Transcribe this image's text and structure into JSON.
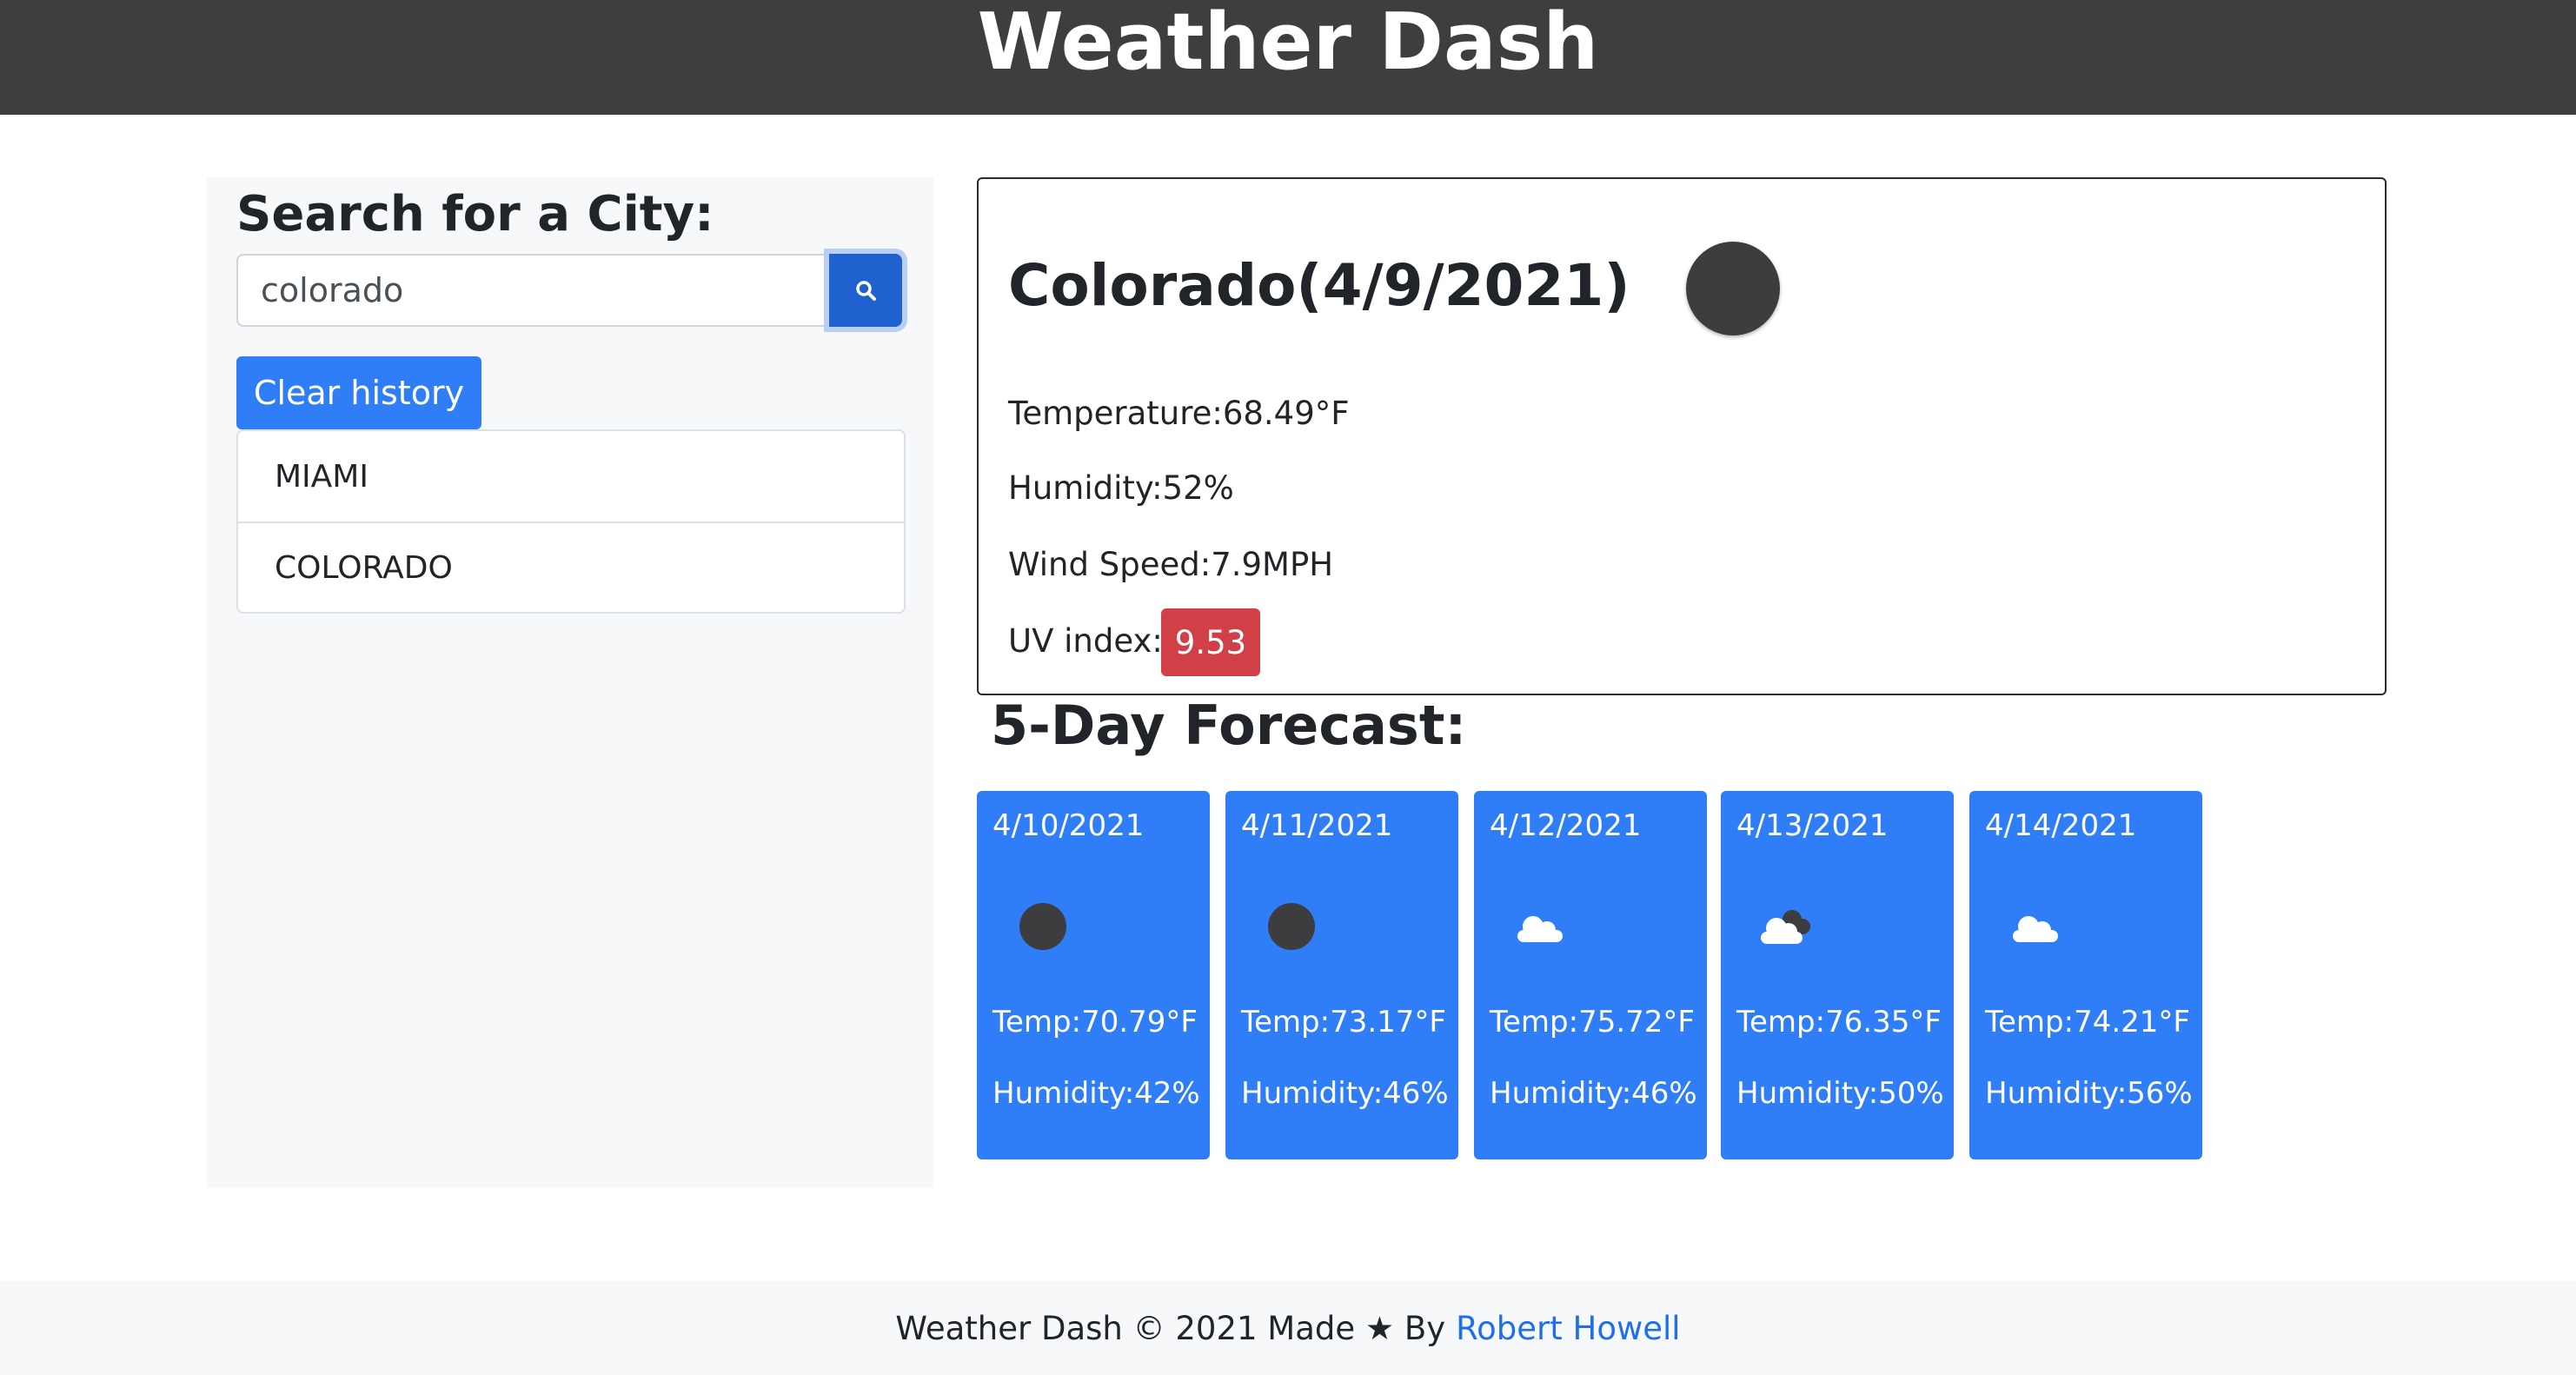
{
  "header": {
    "title": "Weather Dash"
  },
  "search": {
    "label": "Search for a City:",
    "value": "colorado",
    "button_icon": "search-icon",
    "clear_label": "Clear history",
    "history": [
      "MIAMI",
      "COLORADO"
    ]
  },
  "current": {
    "title": "Colorado(4/9/2021)",
    "icon": "dark-circle-icon",
    "temperature": "Temperature:68.49°F",
    "humidity": "Humidity:52%",
    "wind": "Wind Speed:7.9MPH",
    "uv_label": "UV index:",
    "uv_value": "9.53"
  },
  "forecast": {
    "title": "5-Day Forecast:",
    "days": [
      {
        "date": "4/10/2021",
        "icon": "dark-circle-icon",
        "temp": "Temp:70.79°F",
        "humidity": "Humidity:42%"
      },
      {
        "date": "4/11/2021",
        "icon": "dark-circle-icon",
        "temp": "Temp:73.17°F",
        "humidity": "Humidity:46%"
      },
      {
        "date": "4/12/2021",
        "icon": "cloud-icon",
        "temp": "Temp:75.72°F",
        "humidity": "Humidity:46%"
      },
      {
        "date": "4/13/2021",
        "icon": "broken-clouds-icon",
        "temp": "Temp:76.35°F",
        "humidity": "Humidity:50%"
      },
      {
        "date": "4/14/2021",
        "icon": "cloud-icon",
        "temp": "Temp:74.21°F",
        "humidity": "Humidity:56%"
      }
    ]
  },
  "footer": {
    "text": "Weather Dash © 2021 Made ★ By",
    "author": "Robert Howell"
  },
  "colors": {
    "header_bg": "#3e3e3e",
    "accent": "#2f7df7",
    "uv_high": "#d13f47",
    "link": "#1e6fe8"
  }
}
